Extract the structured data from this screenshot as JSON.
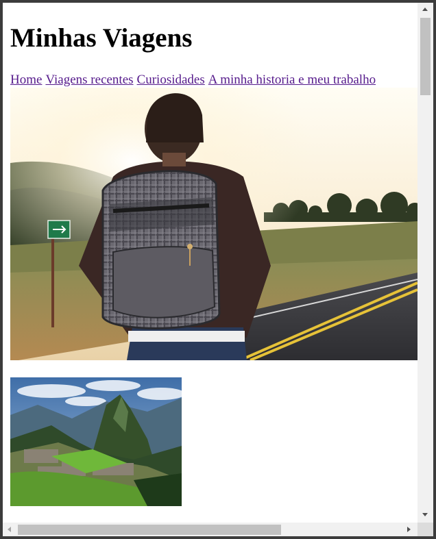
{
  "page": {
    "title": "Minhas Viagens"
  },
  "nav": {
    "items": [
      {
        "label": "Home"
      },
      {
        "label": "Viagens recentes"
      },
      {
        "label": "Curiosidades"
      },
      {
        "label": "A minha historia e meu trabalho"
      }
    ]
  },
  "images": {
    "hero": {
      "name": "backpacker-on-road-photo"
    },
    "thumbnail": {
      "name": "machu-picchu-photo"
    }
  },
  "colors": {
    "link_visited": "#551a8b",
    "scrollbar_track": "#f1f1f1",
    "scrollbar_thumb": "#c1c1c1"
  }
}
